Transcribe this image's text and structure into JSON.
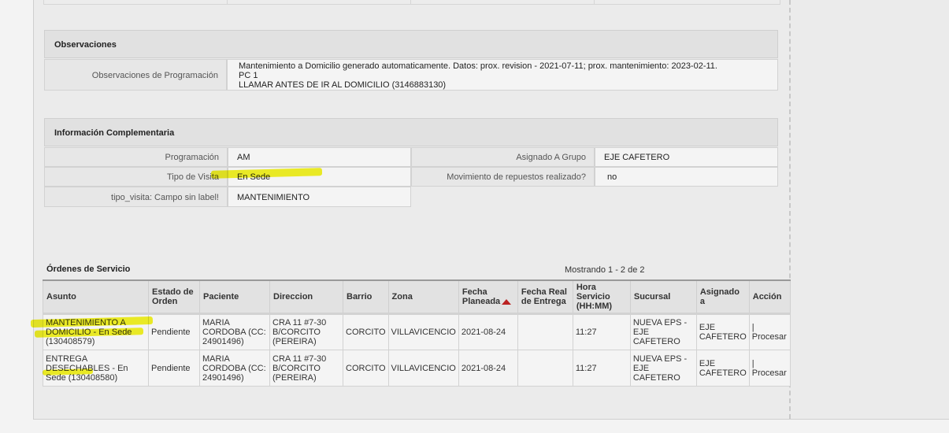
{
  "observaciones": {
    "title": "Observaciones",
    "label": "Observaciones de Programación",
    "lines": [
      "Mantenimiento a Domicilio generado automaticamente. Datos: prox. revision - 2021-07-11; prox. mantenimiento: 2023-02-11.",
      "PC 1",
      "LLAMAR ANTES DE IR AL DOMICILIO (3146883130)"
    ]
  },
  "info": {
    "title": "Información Complementaria",
    "programacion_label": "Programación",
    "programacion_value": "AM",
    "asignado_label": "Asignado A Grupo",
    "asignado_value": "EJE CAFETERO",
    "tipo_visita_label": "Tipo de Visita",
    "tipo_visita_value": "En Sede",
    "movimiento_label": "Movimiento de repuestos realizado?",
    "movimiento_value": "no",
    "campo_label": "tipo_visita: Campo sin label!",
    "campo_value": "MANTENIMIENTO"
  },
  "orders": {
    "title": "Órdenes de Servicio",
    "count": "Mostrando 1 - 2 de 2",
    "headers": {
      "asunto": "Asunto",
      "estado": "Estado de Orden",
      "paciente": "Paciente",
      "direccion": "Direccion",
      "barrio": "Barrio",
      "zona": "Zona",
      "fecha_planeada": "Fecha Planeada",
      "fecha_real": "Fecha Real de Entrega",
      "hora": "Hora Servicio (HH:MM)",
      "sucursal": "Sucursal",
      "asignado": "Asignado a",
      "accion": "Acción"
    },
    "rows": [
      {
        "asunto": "MANTENIMIENTO A DOMICILIO - En Sede (130408579)",
        "estado": "Pendiente",
        "paciente": "MARIA CORDOBA (CC: 24901496)",
        "direccion": "CRA 11 #7-30 B/CORCITO (PEREIRA)",
        "barrio": "CORCITO",
        "zona": "VILLAVICENCIO",
        "fecha_planeada": "2021-08-24",
        "fecha_real": "",
        "hora": "11:27",
        "sucursal": "NUEVA EPS - EJE CAFETERO",
        "asignado": "EJE CAFETERO",
        "accion": "| Procesar"
      },
      {
        "asunto": "ENTREGA DESECHABLES - En Sede (130408580)",
        "estado": "Pendiente",
        "paciente": "MARIA CORDOBA (CC: 24901496)",
        "direccion": "CRA 11 #7-30 B/CORCITO (PEREIRA)",
        "barrio": "CORCITO",
        "zona": "VILLAVICENCIO",
        "fecha_planeada": "2021-08-24",
        "fecha_real": "",
        "hora": "11:27",
        "sucursal": "NUEVA EPS - EJE CAFETERO",
        "asignado": "EJE CAFETERO",
        "accion": "| Procesar"
      }
    ]
  },
  "colors": {
    "highlight": "#f2f200",
    "sort_arrow": "#b22222"
  }
}
